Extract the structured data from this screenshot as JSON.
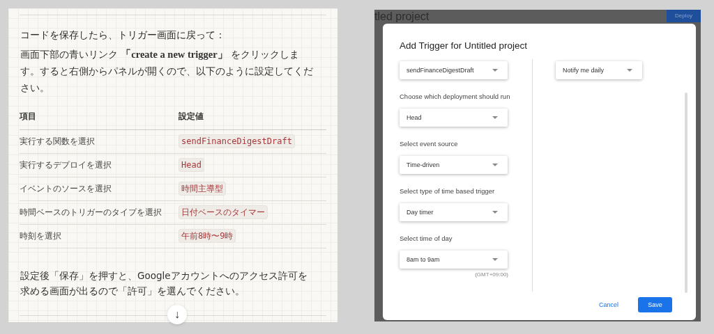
{
  "article": {
    "heading": "コードを保存したら、トリガー画面に戻って：",
    "intro": "画面下部の青いリンク **「create a new trigger」** をクリックします。すると右側からパネルが開くので、以下のように設定してください。",
    "table": {
      "columns": [
        "項目",
        "設定値"
      ],
      "rows": [
        {
          "item": "実行する関数を選択",
          "value": "sendFinanceDigestDraft"
        },
        {
          "item": "実行するデプロイを選択",
          "value": "Head"
        },
        {
          "item": "イベントのソースを選択",
          "value": "時間主導型"
        },
        {
          "item": "時間ベースのトリガーのタイプを選択",
          "value": "日付ベースのタイマー"
        },
        {
          "item": "時刻を選択",
          "value": "午前8時〜9時"
        }
      ]
    },
    "outro": "設定後「保存」を押すと、Googleアカウントへのアクセス許可を求める画面が出るので「許可」を選んでください。",
    "scroll_down": "↓"
  },
  "screenshot": {
    "background_title": "tled project",
    "deploy_button": "Deploy",
    "dialog": {
      "title": "Add Trigger for Untitled project",
      "left_fields": [
        {
          "value": "sendFinanceDigestDraft"
        },
        {
          "label": "Choose which deployment should run",
          "value": "Head"
        },
        {
          "label": "Select event source",
          "value": "Time-driven"
        },
        {
          "label": "Select type of time based trigger",
          "value": "Day timer"
        },
        {
          "label": "Select time of day",
          "value": "8am to 9am"
        }
      ],
      "timezone": "(GMT+09:00)",
      "right_fields": [
        {
          "value": "Notify me daily"
        }
      ],
      "cancel": "Cancel",
      "save": "Save"
    }
  }
}
